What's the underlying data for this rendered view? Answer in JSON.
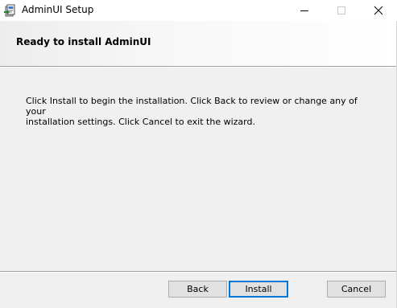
{
  "window": {
    "title": "AdminUI Setup"
  },
  "banner": {
    "title": "Ready to install AdminUI"
  },
  "body": {
    "line1": "Click Install to begin the installation. Click Back to review or change any of your",
    "line2": "installation settings. Click Cancel to exit the wizard."
  },
  "buttons": {
    "back": "Back",
    "install": "Install",
    "cancel": "Cancel"
  },
  "colors": {
    "focus_border": "#0078d7",
    "button_face": "#e1e1e1",
    "dialog_background": "#f0f0f0"
  },
  "icons": {
    "app": "installer-package-icon",
    "minimize": "minimize-icon",
    "maximize": "maximize-icon",
    "close": "close-icon"
  }
}
